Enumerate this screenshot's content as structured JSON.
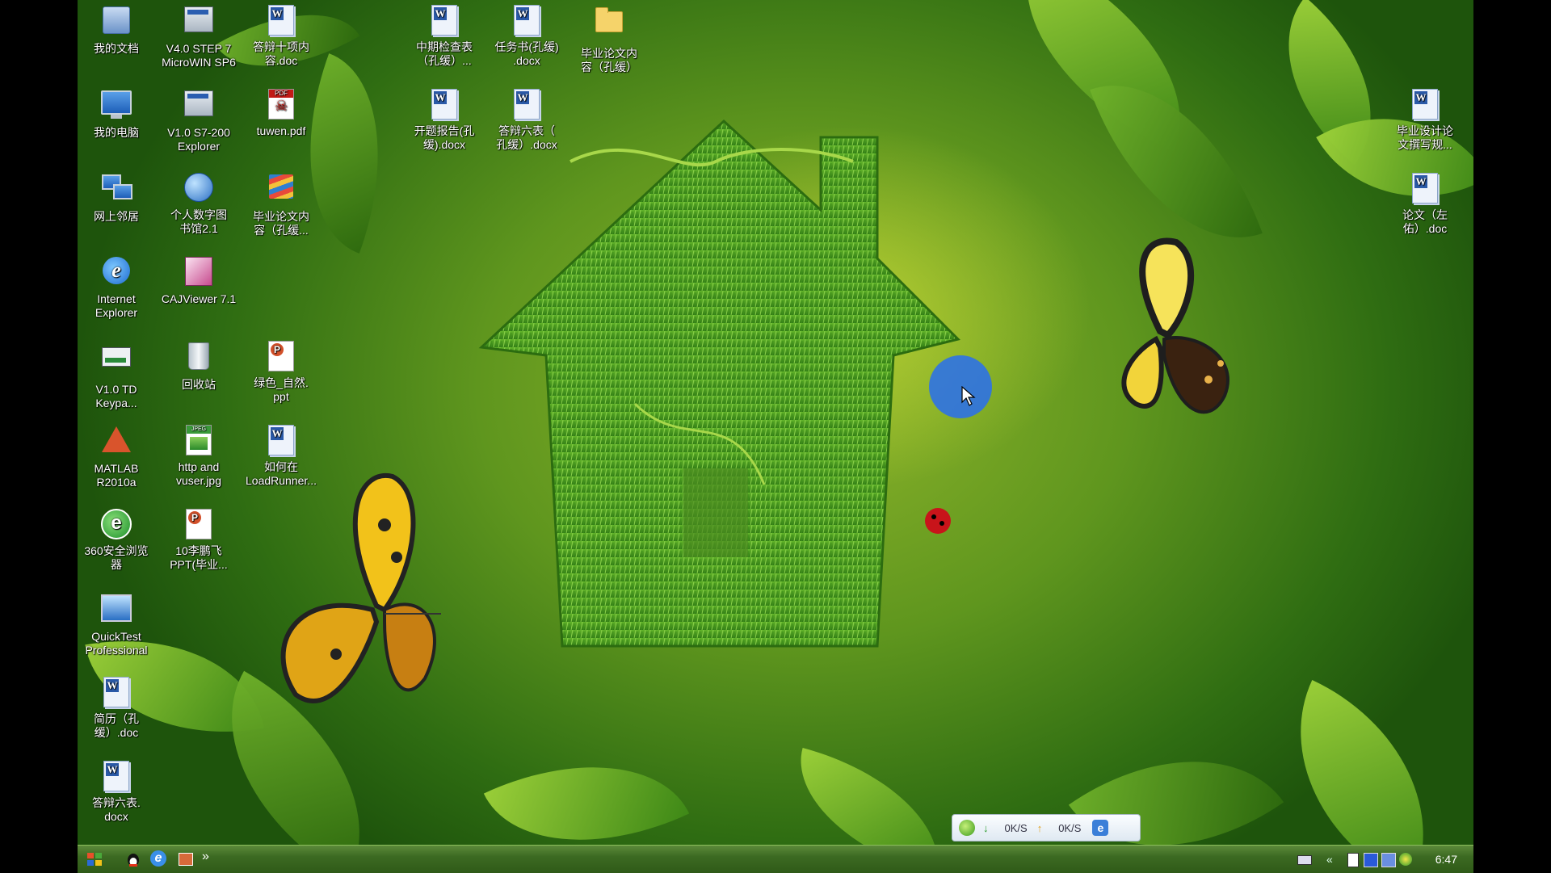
{
  "desktop": {
    "icons": [
      {
        "label": "我的文档",
        "icon": "my-documents-icon"
      },
      {
        "label": "V4.0 STEP 7\nMicroWIN SP6",
        "icon": "microwin-app-icon"
      },
      {
        "label": "答辩十项内\n容.doc",
        "icon": "word-doc-icon"
      },
      {
        "label": "中期检查表\n（孔缓）...",
        "icon": "word-doc-icon"
      },
      {
        "label": "任务书(孔缓)\n.docx",
        "icon": "word-doc-icon"
      },
      {
        "label": "毕业论文内\n容（孔缓）",
        "icon": "folder-icon"
      },
      {
        "label": "我的电脑",
        "icon": "my-computer-icon"
      },
      {
        "label": "V1.0 S7-200\nExplorer",
        "icon": "s7-explorer-icon"
      },
      {
        "label": "tuwen.pdf",
        "icon": "pdf-icon"
      },
      {
        "label": "开题报告(孔\n缓).docx",
        "icon": "word-doc-icon"
      },
      {
        "label": "答辩六表（\n孔缓）.docx",
        "icon": "word-doc-icon"
      },
      {
        "label": "网上邻居",
        "icon": "network-places-icon"
      },
      {
        "label": "个人数字图\n书馆2.1",
        "icon": "digital-library-icon"
      },
      {
        "label": "毕业论文内\n容（孔缓...",
        "icon": "winrar-archive-icon"
      },
      {
        "label": "Internet\nExplorer",
        "icon": "internet-explorer-icon"
      },
      {
        "label": "CAJViewer 7.1",
        "icon": "cajviewer-icon"
      },
      {
        "label": "V1.0 TD\nKeypa...",
        "icon": "td-keypad-icon"
      },
      {
        "label": "回收站",
        "icon": "recycle-bin-icon"
      },
      {
        "label": "绿色_自然.\nppt",
        "icon": "powerpoint-icon"
      },
      {
        "label": "MATLAB\nR2010a",
        "icon": "matlab-icon"
      },
      {
        "label": "http and\nvuser.jpg",
        "icon": "jpeg-image-icon"
      },
      {
        "label": "如何在\nLoadRunner...",
        "icon": "word-doc-icon"
      },
      {
        "label": "360安全浏览\n器",
        "icon": "360-browser-icon"
      },
      {
        "label": "10李鹏飞\nPPT(毕业...",
        "icon": "powerpoint-icon"
      },
      {
        "label": "QuickTest\nProfessional",
        "icon": "quicktest-icon"
      },
      {
        "label": "简历（孔\n缓）.doc",
        "icon": "word-doc-icon"
      },
      {
        "label": "答辩六表.\ndocx",
        "icon": "word-doc-icon"
      },
      {
        "label": "毕业设计论\n文撰写规...",
        "icon": "word-doc-icon"
      },
      {
        "label": "论文（左\n佑）.doc",
        "icon": "word-doc-icon"
      }
    ]
  },
  "speed_widget": {
    "download": "0K/S",
    "upload": "0K/S"
  },
  "taskbar": {
    "quick_launch_more": "»",
    "clock": "6:47"
  },
  "colors": {
    "taskbar": "#3c6a22",
    "cursor_ring": "#286ef0",
    "wallpaper_green": "#5f961e"
  }
}
